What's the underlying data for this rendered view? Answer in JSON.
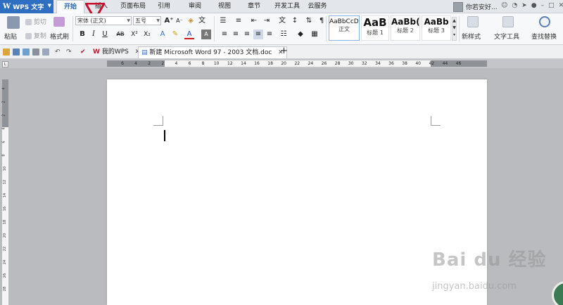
{
  "app": {
    "name": "WPS 文字",
    "logo": "W"
  },
  "menu": {
    "tabs": [
      "开始",
      "插入",
      "页面布局",
      "引用",
      "审阅",
      "视图",
      "章节",
      "开发工具",
      "云服务"
    ],
    "active_tab": "开始"
  },
  "user": {
    "name": "你若安好..."
  },
  "ribbon": {
    "clipboard": {
      "paste": "粘贴",
      "cut": "剪切",
      "copy": "复制",
      "format_painter": "格式刷"
    },
    "font": {
      "name": "宋体 (正文)",
      "size": "五号"
    },
    "format_buttons": [
      "B",
      "I",
      "U",
      "AB",
      "X²",
      "X₂"
    ],
    "styles": [
      {
        "sample": "AaBbCcDd",
        "label": "正文"
      },
      {
        "sample": "AaB",
        "label": "标题 1"
      },
      {
        "sample": "AaBb(",
        "label": "标题 2"
      },
      {
        "sample": "AaBb",
        "label": "标题 3"
      }
    ],
    "new_style": "新样式",
    "text_tools": "文字工具",
    "find_replace": "查找替换"
  },
  "doc_tabs": [
    {
      "label": "我的WPS",
      "active": false
    },
    {
      "label": "新建 Microsoft Word 97 - 2003 文档.doc",
      "active": true
    }
  ],
  "ruler": {
    "h_numbers": [
      "6",
      "4",
      "2",
      "2",
      "4",
      "6",
      "8",
      "10",
      "12",
      "14",
      "16",
      "18",
      "20",
      "22",
      "24",
      "26",
      "28",
      "30",
      "32",
      "34",
      "36",
      "38",
      "40",
      "42",
      "44",
      "46"
    ],
    "v_numbers": [
      "4",
      "2",
      "2",
      "4",
      "6",
      "8",
      "10",
      "12",
      "14",
      "16",
      "18",
      "20",
      "22",
      "24",
      "26",
      "28"
    ]
  },
  "watermark": {
    "main": "Bai du 经验",
    "sub": "jingyan.baidu.com"
  },
  "colors": {
    "accent": "#2f6fc2",
    "annotation": "#c8102e"
  }
}
